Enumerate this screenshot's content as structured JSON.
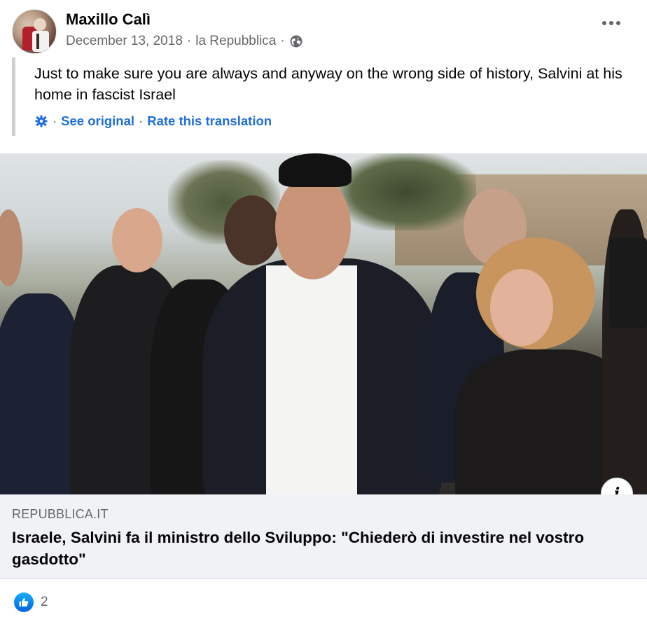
{
  "post": {
    "author": "Maxillo Calì",
    "date": "December 13, 2018",
    "source": "la Repubblica",
    "sep": "·",
    "text": "Just to make sure you are always and anyway on the wrong side of history, Salvini at his home in fascist Israel",
    "translation": {
      "see_original": "See original",
      "rate_translation": "Rate this translation",
      "dot": "·"
    },
    "icons": {
      "privacy": "globe-icon",
      "menu": "more-options-icon",
      "translation": "gear-icon",
      "info": "info-icon",
      "reaction": "like-icon"
    }
  },
  "link_preview": {
    "domain": "REPUBBLICA.IT",
    "headline": "Israele, Salvini fa il ministro dello Sviluppo: \"Chiederò di investire nel vostro gasdotto\"",
    "info_glyph": "i"
  },
  "reactions": {
    "count": "2"
  },
  "colors": {
    "link_blue": "#216fdb",
    "secondary_text": "#65676b",
    "preview_bg": "#f0f2f5",
    "like_blue": "#1877f2"
  }
}
